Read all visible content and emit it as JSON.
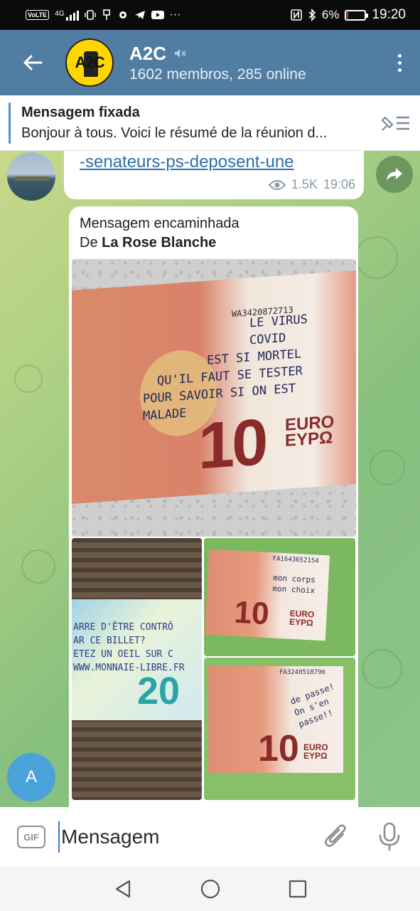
{
  "status_bar": {
    "volte": "VoLTE",
    "network": "4G",
    "battery_pct": "6%",
    "time": "19:20",
    "battery_level": 0.06
  },
  "header": {
    "title": "A2C",
    "subtitle": "1602 membros, 285 online",
    "avatar_text": "A2C"
  },
  "pinned": {
    "title": "Mensagem fixada",
    "text": "Bonjour à tous. Voici le résumé de la réunion d..."
  },
  "messages": {
    "first": {
      "link_text": "-senateurs-ps-deposent-une",
      "views": "1.5K",
      "time": "19:06"
    },
    "forwarded": {
      "label": "Mensagem encaminhada",
      "from_prefix": "De ",
      "from_name": "La Rose Blanche"
    }
  },
  "photos": {
    "main": {
      "serial": "WA3420872713",
      "handwriting": [
        "LE VIRUS COVID",
        "EST SI MORTEL",
        "QU'IL FAUT SE TESTER",
        "POUR SAVOIR SI ON EST",
        "MALADE"
      ],
      "denomination": "10",
      "currency_lines": [
        "EURO",
        "EYPΩ"
      ]
    },
    "bottom_left": {
      "handwriting": [
        "ARRE D'ÊTRE CONTRÔ",
        "AR CE BILLET?",
        "ETEZ UN OEIL SUR C",
        "WWW.MONNAIE-LIBRE.FR"
      ],
      "denomination": "20"
    },
    "top_right": {
      "serial": "FA1643652154",
      "handwriting": [
        "mon corps",
        "mon choix"
      ],
      "denomination": "10",
      "currency_lines": [
        "EURO",
        "EYPΩ"
      ]
    },
    "bottom_right": {
      "serial": "FA3240518796",
      "handwriting": [
        "de passe!",
        "On s'en",
        "passe!!"
      ],
      "denomination": "10",
      "currency_lines": [
        "EURO",
        "EYPΩ"
      ]
    }
  },
  "floating_avatar": {
    "letter": "A"
  },
  "input": {
    "gif_label": "GIF",
    "placeholder": "Mensagem"
  },
  "icons": {
    "back": "arrow-left-icon",
    "mute": "mute-icon",
    "menu": "more-vert-icon",
    "unpin": "unpin-list-icon",
    "share": "share-arrow-icon",
    "views": "eye-icon",
    "attach": "paperclip-icon",
    "mic": "mic-icon"
  },
  "colors": {
    "header": "#527da3",
    "link": "#2f6ea8",
    "floating_avatar": "#4aa3d8"
  }
}
